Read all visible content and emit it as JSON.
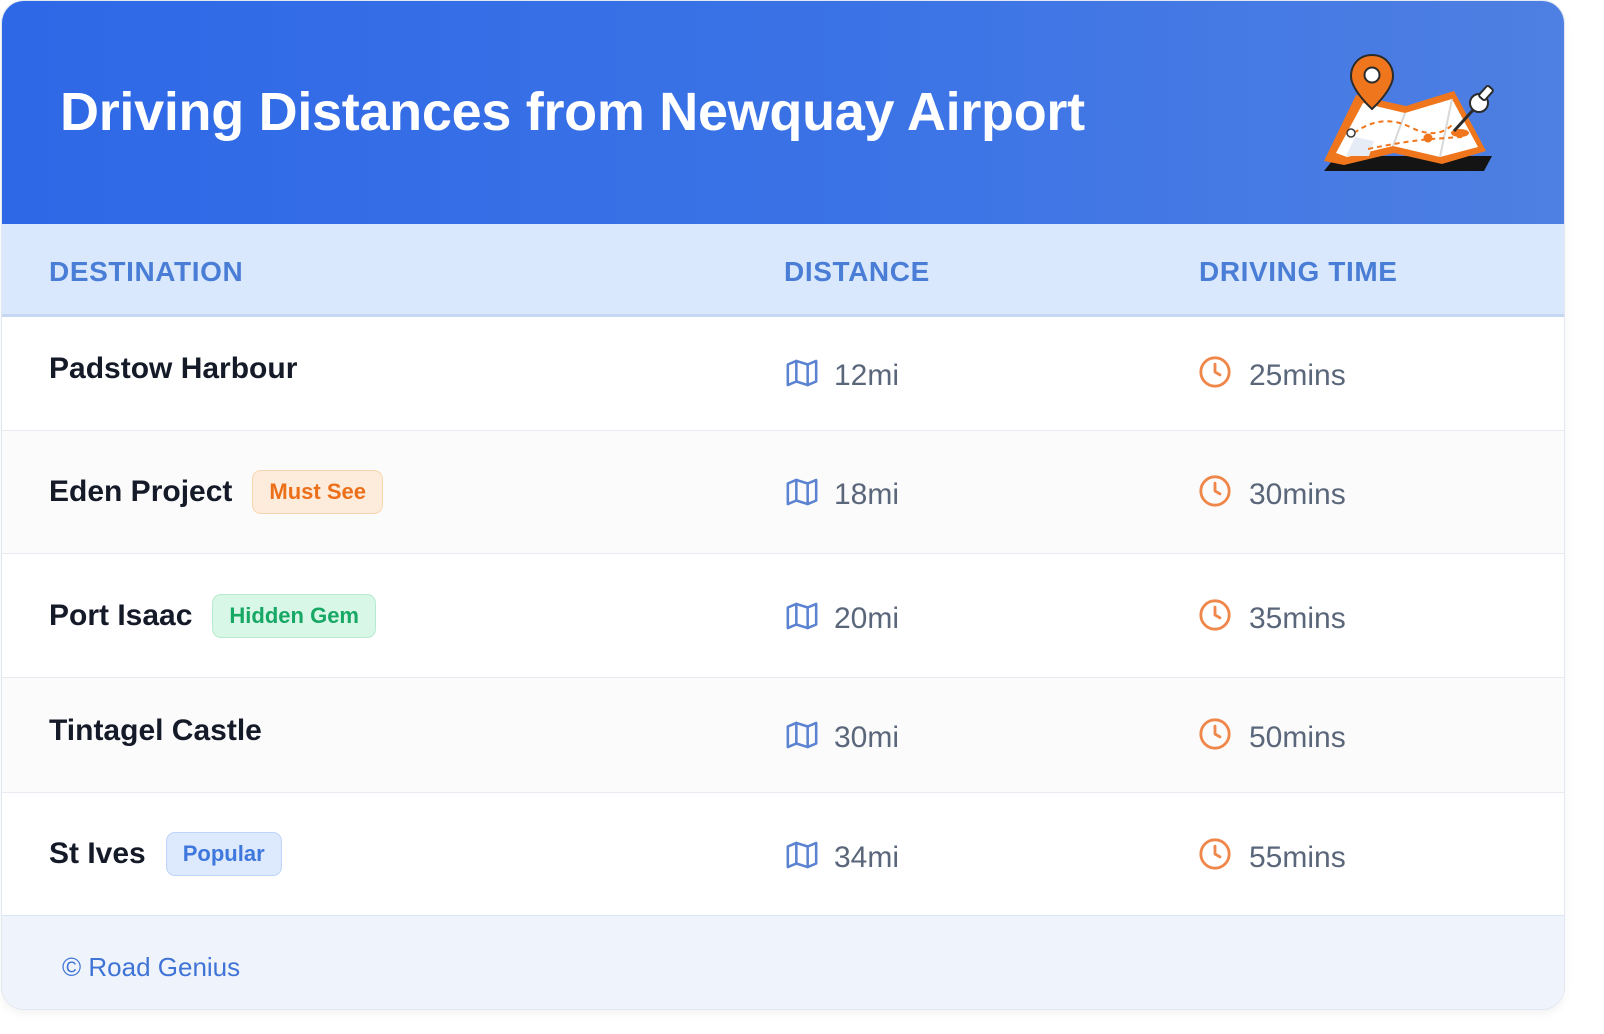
{
  "header": {
    "title": "Driving Distances from Newquay Airport",
    "illustration_icon": "folded-map-with-pins-icon",
    "background": "#2e68e6"
  },
  "table": {
    "columns": [
      "DESTINATION",
      "DISTANCE",
      "DRIVING TIME"
    ],
    "distance_icon": "map-icon",
    "time_icon": "clock-icon",
    "rows": [
      {
        "destination": "Padstow Harbour",
        "badge": "",
        "badge_color": "",
        "distance": "12mi",
        "time": "25mins"
      },
      {
        "destination": "Eden Project",
        "badge": "Must See",
        "badge_color": "orange",
        "distance": "18mi",
        "time": "30mins"
      },
      {
        "destination": "Port Isaac",
        "badge": "Hidden Gem",
        "badge_color": "green",
        "distance": "20mi",
        "time": "35mins"
      },
      {
        "destination": "Tintagel Castle",
        "badge": "",
        "badge_color": "",
        "distance": "30mi",
        "time": "50mins"
      },
      {
        "destination": "St Ives",
        "badge": "Popular",
        "badge_color": "blue",
        "distance": "34mi",
        "time": "55mins"
      }
    ]
  },
  "footer": {
    "text": "© Road Genius"
  },
  "colors": {
    "header_bg": "#2e68e6",
    "column_header_bg": "#dae8fd",
    "column_header_text": "#4a7ed6",
    "distance_icon": "#5b83d1",
    "clock_icon": "#f0874a",
    "footer_bg": "#eff4fc",
    "footer_text": "#3f74d6"
  }
}
